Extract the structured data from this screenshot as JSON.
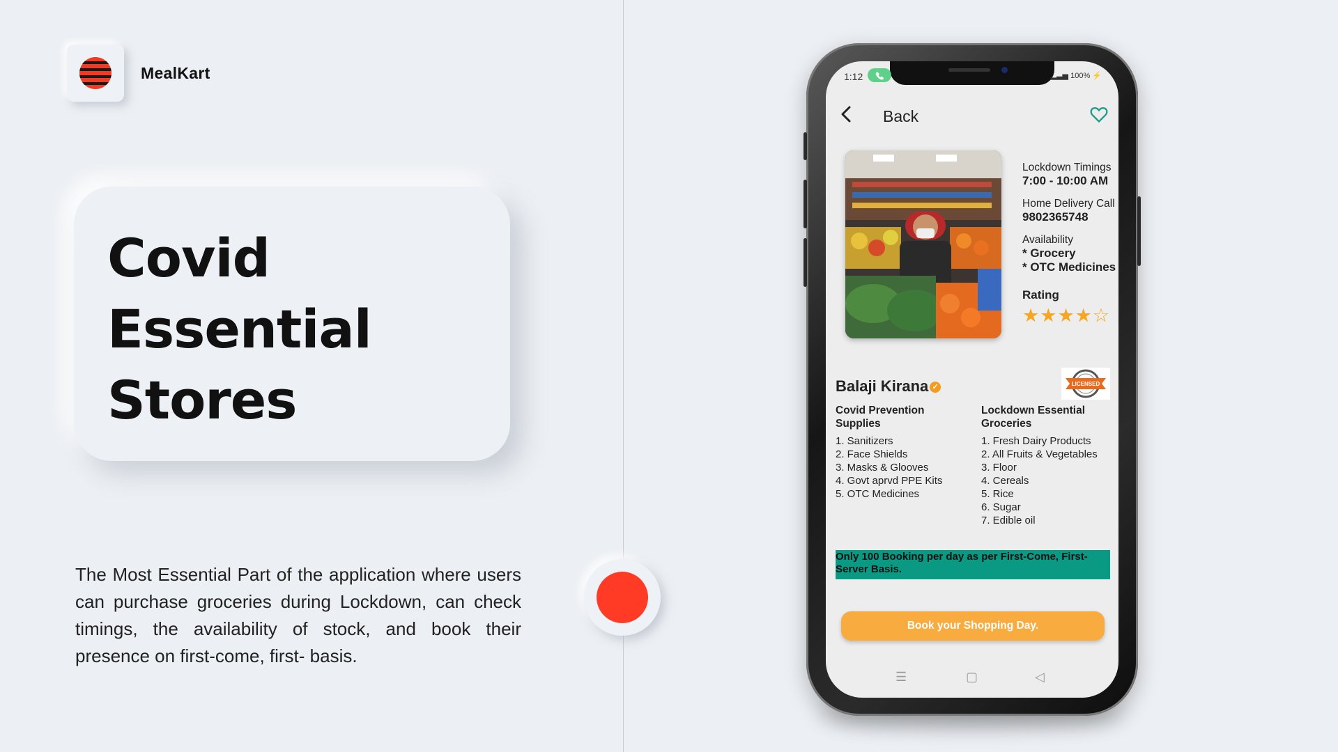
{
  "brand": {
    "name": "MealKart",
    "logo_icon": "striped-sphere-logo",
    "accent": "#ff3b25"
  },
  "hero": {
    "title_lines": [
      "Covid",
      "Essential",
      "Stores"
    ]
  },
  "description": "The Most Essential Part of the application where users can purchase groceries during Lockdown, can check timings, the availability of stock, and book their presence on first-come, first- basis.",
  "phone": {
    "status": {
      "time": "1:12",
      "battery": "100%"
    },
    "header": {
      "back_label": "Back",
      "favorite_icon": "heart-icon"
    },
    "store_info": {
      "lockdown_label": "Lockdown Timings",
      "lockdown_value": "7:00 - 10:00 AM",
      "delivery_label": "Home Delivery Call",
      "delivery_value": "9802365748",
      "availability_label": "Availability",
      "availability_items": [
        "* Grocery",
        "* OTC Medicines"
      ],
      "rating_label": "Rating",
      "rating_value": 4,
      "rating_max": 5
    },
    "store_name": "Balaji Kirana",
    "badge_text": "LICENSED",
    "covid_supplies": {
      "heading": "Covid Prevention Supplies",
      "items": [
        "1. Sanitizers",
        "2. Face Shields",
        "3. Masks & Glooves",
        "4. Govt aprvd PPE Kits",
        "5. OTC Medicines"
      ]
    },
    "groceries": {
      "heading": "Lockdown Essential Groceries",
      "items": [
        "1. Fresh Dairy Products",
        "2. All Fruits & Vegetables",
        "3. Floor",
        "4. Cereals",
        "5. Rice",
        "6. Sugar",
        "7. Edible oil"
      ]
    },
    "notice": "Only 100 Booking per day as per First-Come, First-Server Basis.",
    "book_button": "Book your Shopping Day.",
    "colors": {
      "notice_bg": "#0a9a84",
      "button_bg": "#f8ab3f",
      "star": "#f5a623"
    }
  }
}
